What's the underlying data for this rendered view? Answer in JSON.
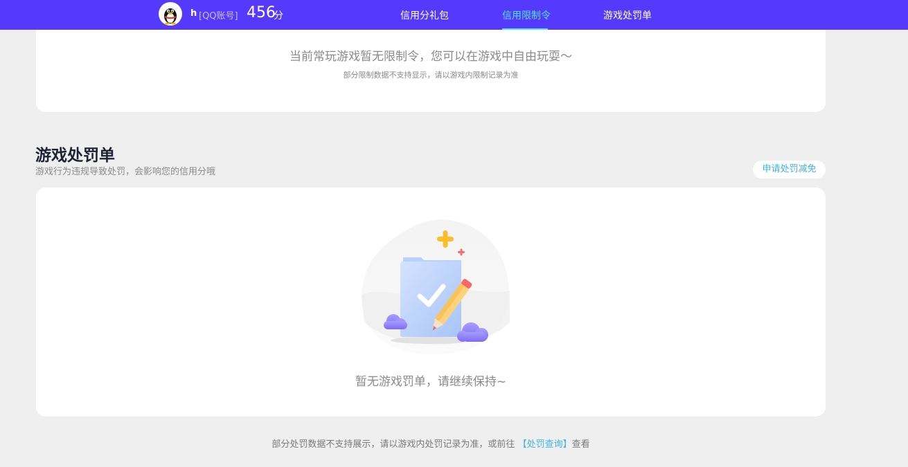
{
  "header": {
    "username": "h",
    "account_tag": "[QQ账号]",
    "score": "456",
    "score_unit": "分",
    "nav": [
      {
        "label": "信用分礼包",
        "active": false
      },
      {
        "label": "信用限制令",
        "active": true
      },
      {
        "label": "游戏处罚单",
        "active": false
      }
    ],
    "colors": {
      "bar": "#5539fc",
      "active": "#4fe3ff"
    }
  },
  "restriction": {
    "empty_message": "当前常玩游戏暂无限制令，您可以在游戏中自由玩耍～",
    "note": "部分限制数据不支持显示，请以游戏内限制记录为准"
  },
  "penalty": {
    "title": "游戏处罚单",
    "description": "游戏行为违规导致处罚，会影响您的信用分哦",
    "appeal_button": "申请处罚减免",
    "empty_message": "暂无游戏罚单，请继续保持~"
  },
  "footer": {
    "text_before": "部分处罚数据不支持展示，请以游戏内处罚记录为准，或前往",
    "link": "【处罚查询】",
    "text_after": "查看"
  },
  "icons": [
    "qq-penguin-avatar-icon",
    "empty-state-illustration-icon"
  ]
}
